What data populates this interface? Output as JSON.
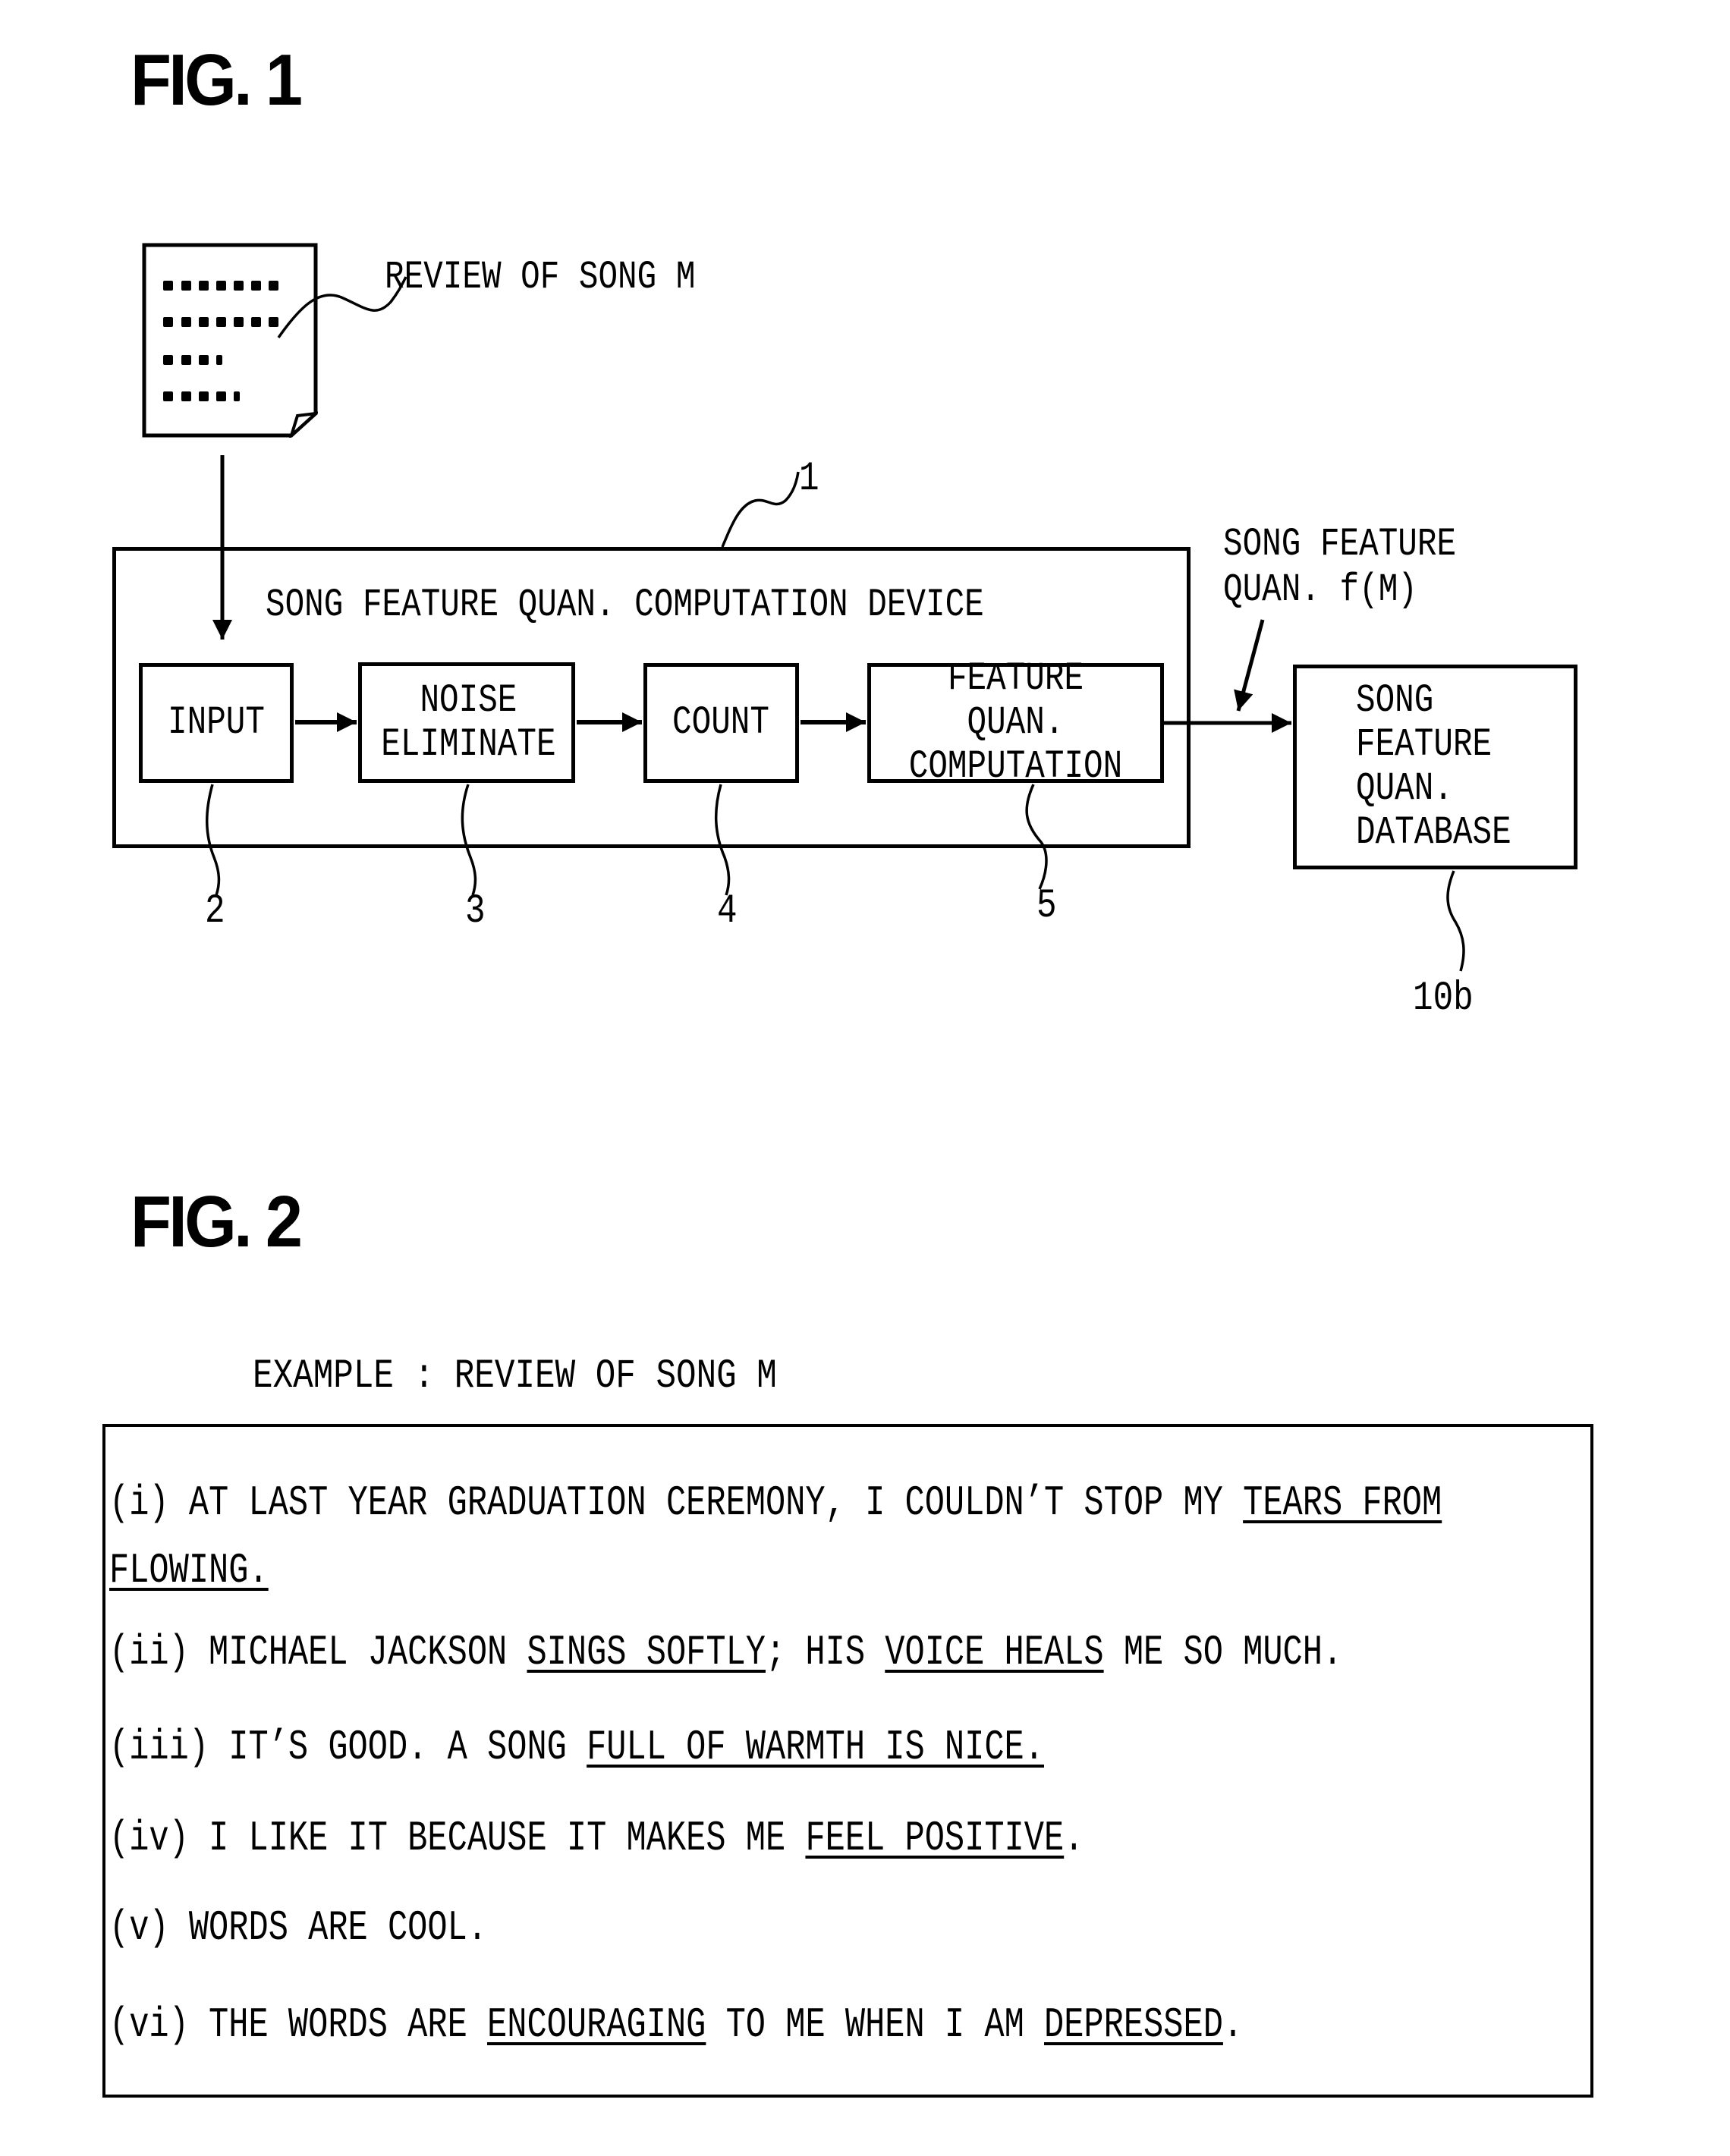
{
  "fig1": {
    "title": "FIG. 1",
    "document_label": "REVIEW OF SONG M",
    "document_icon": "document-icon",
    "device": {
      "ref": "1",
      "title": "SONG FEATURE QUAN. COMPUTATION DEVICE",
      "blocks": [
        {
          "label": "INPUT",
          "ref": "2"
        },
        {
          "label": "NOISE\nELIMINATE",
          "ref": "3"
        },
        {
          "label": "COUNT",
          "ref": "4"
        },
        {
          "label": "FEATURE QUAN.\nCOMPUTATION",
          "ref": "5"
        }
      ]
    },
    "output_label_line1": "SONG FEATURE",
    "output_label_line2": "QUAN. f(M)",
    "database": {
      "label": "SONG\nFEATURE\nQUAN.\nDATABASE",
      "ref": "10b"
    }
  },
  "fig2": {
    "title": "FIG. 2",
    "caption": "EXAMPLE : REVIEW OF SONG M",
    "sentences": [
      {
        "id": "i",
        "segments": [
          {
            "text": "(i) AT LAST YEAR GRADUATION CEREMONY, I COULDN’T STOP MY ",
            "underline": false
          },
          {
            "text": "TEARS FROM",
            "underline": true
          }
        ]
      },
      {
        "id": "i-cont",
        "segments": [
          {
            "text": "FLOWING.",
            "underline": true
          }
        ]
      },
      {
        "id": "ii",
        "segments": [
          {
            "text": "(ii) MICHAEL JACKSON ",
            "underline": false
          },
          {
            "text": "SINGS SOFTLY",
            "underline": true
          },
          {
            "text": "; HIS ",
            "underline": false
          },
          {
            "text": "VOICE HEALS",
            "underline": true
          },
          {
            "text": " ME SO MUCH.",
            "underline": false
          }
        ]
      },
      {
        "id": "iii",
        "segments": [
          {
            "text": "(iii) IT’S GOOD. A SONG ",
            "underline": false
          },
          {
            "text": "FULL OF WARMTH IS NICE.",
            "underline": true
          }
        ]
      },
      {
        "id": "iv",
        "segments": [
          {
            "text": "(iv) I LIKE IT BECAUSE IT MAKES ME ",
            "underline": false
          },
          {
            "text": "FEEL POSITIVE",
            "underline": true
          },
          {
            "text": ".",
            "underline": false
          }
        ]
      },
      {
        "id": "v",
        "segments": [
          {
            "text": "(v) WORDS ARE COOL.",
            "underline": false
          }
        ]
      },
      {
        "id": "vi",
        "segments": [
          {
            "text": "(vi) THE WORDS ARE ",
            "underline": false
          },
          {
            "text": "ENCOURAGING",
            "underline": true
          },
          {
            "text": " TO ME WHEN I AM ",
            "underline": false
          },
          {
            "text": "DEPRESSED",
            "underline": true
          },
          {
            "text": ".",
            "underline": false
          }
        ]
      }
    ]
  }
}
